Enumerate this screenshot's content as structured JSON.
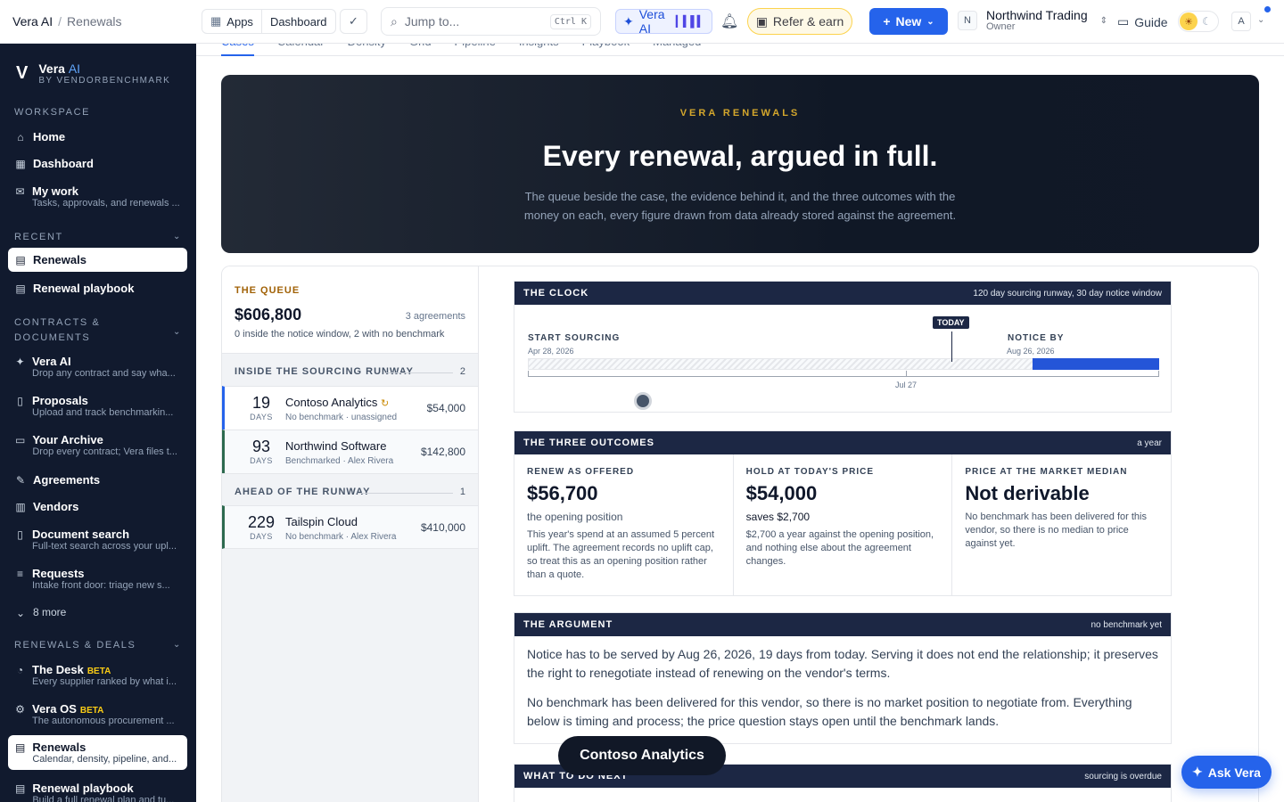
{
  "topbar": {
    "crumb_app": "Vera AI",
    "crumb_sep": "/",
    "crumb_page": "Renewals",
    "apps_label": "Apps",
    "dashboard_label": "Dashboard",
    "jump_placeholder": "Jump to...",
    "jump_kbd": "Ctrl K",
    "vera_label": "Vera AI",
    "refer_label": "Refer & earn",
    "new_label": "New",
    "org_badge": "N",
    "org_name": "Northwind Trading",
    "org_role": "Owner",
    "guide_label": "Guide",
    "avatar_letter": "A",
    "accent": "#2563eb"
  },
  "sidebar": {
    "brand_name": "Vera",
    "brand_ai": "AI",
    "brand_by": "BY VENDORBENCHMARK",
    "sections": {
      "workspace": "WORKSPACE",
      "recent": "RECENT",
      "contracts": "CONTRACTS &",
      "contracts2": "DOCUMENTS",
      "renewals": "RENEWALS & DEALS"
    },
    "items": [
      {
        "label": "Home",
        "sub": ""
      },
      {
        "label": "Dashboard",
        "sub": ""
      },
      {
        "label": "My work",
        "sub": "Tasks, approvals, and renewals ..."
      },
      {
        "label": "Renewals",
        "sub": ""
      },
      {
        "label": "Renewal playbook",
        "sub": ""
      },
      {
        "label": "Vera AI",
        "sub": "Drop any contract and say wha..."
      },
      {
        "label": "Proposals",
        "sub": "Upload and track benchmarkin..."
      },
      {
        "label": "Your Archive",
        "sub": "Drop every contract; Vera files t..."
      },
      {
        "label": "Agreements",
        "sub": ""
      },
      {
        "label": "Vendors",
        "sub": ""
      },
      {
        "label": "Document search",
        "sub": "Full-text search across your upl..."
      },
      {
        "label": "Requests",
        "sub": "Intake front door: triage new s..."
      },
      {
        "label": "8 more",
        "sub": ""
      },
      {
        "label": "The Desk",
        "sub": "Every supplier ranked by what i...",
        "badge": "BETA"
      },
      {
        "label": "Vera OS",
        "sub": "The autonomous procurement ...",
        "badge": "BETA"
      },
      {
        "label": "Renewals",
        "sub": "Calendar, density, pipeline, and..."
      },
      {
        "label": "Renewal playbook",
        "sub": "Build a full renewal plan and tu..."
      }
    ]
  },
  "hero": {
    "kicker": "VERA RENEWALS",
    "title": "Every renewal, argued in full.",
    "text": "The queue beside the case, the evidence behind it, and the three outcomes with the money on each, every figure drawn from data already stored against the agreement."
  },
  "tabs": [
    "Cases",
    "Calendar",
    "Density",
    "Grid",
    "Pipeline",
    "Insights",
    "Playbook",
    "Managed"
  ],
  "queue": {
    "kicker": "THE QUEUE",
    "total": "$606,800",
    "count": "3 agreements",
    "summary": "0 inside the notice window, 2 with no benchmark",
    "groups": [
      {
        "title": "INSIDE THE SOURCING RUNWAY",
        "count": "2"
      },
      {
        "title": "AHEAD OF THE RUNWAY",
        "count": "1"
      }
    ],
    "rows": [
      {
        "days": "19",
        "days_label": "DAYS",
        "name": "Contoso Analytics",
        "sub": "No benchmark · unassigned",
        "amount": "$54,000"
      },
      {
        "days": "93",
        "days_label": "DAYS",
        "name": "Northwind Software",
        "sub": "Benchmarked · Alex Rivera",
        "amount": "$142,800"
      },
      {
        "days": "229",
        "days_label": "DAYS",
        "name": "Tailspin Cloud",
        "sub": "No benchmark · Alex Rivera",
        "amount": "$410,000"
      }
    ]
  },
  "clock": {
    "title": "THE CLOCK",
    "note": "120 day sourcing runway, 30 day notice window",
    "today": "TODAY",
    "start_label": "START SOURCING",
    "start_date": "Apr 28, 2026",
    "notice_label": "NOTICE BY",
    "notice_date": "Aug 26, 2026",
    "mid_tick": "Jul 27"
  },
  "outcomes": {
    "title": "THE THREE OUTCOMES",
    "note": "a year",
    "items": [
      {
        "label": "RENEW AS OFFERED",
        "value": "$56,700",
        "sub": "the opening position",
        "desc": "This year's spend at an assumed 5 percent uplift. The agreement records no uplift cap, so treat this as an opening position rather than a quote."
      },
      {
        "label": "HOLD AT TODAY'S PRICE",
        "value": "$54,000",
        "sub": "saves $2,700",
        "desc": "$2,700 a year against the opening position, and nothing else about the agreement changes."
      },
      {
        "label": "PRICE AT THE MARKET MEDIAN",
        "value": "Not derivable",
        "sub": "",
        "desc": "No benchmark has been delivered for this vendor, so there is no median to price against yet."
      }
    ]
  },
  "argument": {
    "title": "THE ARGUMENT",
    "note": "no benchmark yet",
    "p1": "Notice has to be served by Aug 26, 2026, 19 days from today. Serving it does not end the relationship; it preserves the right to renegotiate instead of renewing on the vendor's terms.",
    "p2": "No benchmark has been delivered for this vendor, so there is no market position to negotiate from. Everything below is timing and process; the price question stays open until the benchmark lands."
  },
  "next": {
    "title": "WHAT TO DO NEXT",
    "note": "sourcing is overdue"
  },
  "toast": "Contoso Analytics",
  "ask_vera": "Ask Vera"
}
